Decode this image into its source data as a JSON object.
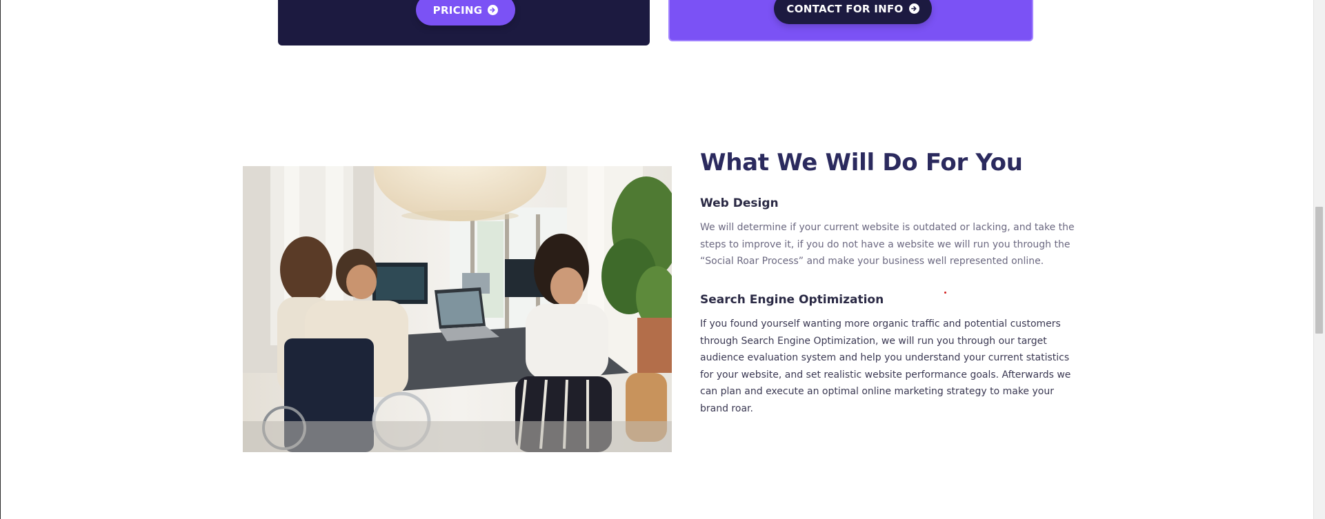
{
  "cards": {
    "pricing_label": "PRICING",
    "contact_label": "CONTACT FOR INFO",
    "pricing_color": "#7b52f5",
    "contact_color": "#1c1a40"
  },
  "section": {
    "title": "What We Will Do For You",
    "photo_alt": "Team working at a table with laptops",
    "items": [
      {
        "heading": "Web Design",
        "body": "We will determine if your current website is outdated or lacking, and take the steps to improve it, if you do not have a website we will run you through the “Social Roar Process” and make your business well represented online."
      },
      {
        "heading": "Search Engine Optimization",
        "body": "If you found yourself wanting more organic traffic and potential customers through Search Engine Optimization, we will run you through our target audience evaluation system and help you understand your current statistics for your website, and set realistic website performance goals. Afterwards we can plan and execute an optimal online marketing strategy to make your brand roar."
      }
    ]
  },
  "colors": {
    "heading": "#2b2a5e",
    "accent": "#7b52f5",
    "dark": "#1c1a40"
  },
  "icons": {
    "pricing_button_icon": "circle-arrow-right-icon",
    "contact_button_icon": "circle-arrow-right-icon"
  }
}
